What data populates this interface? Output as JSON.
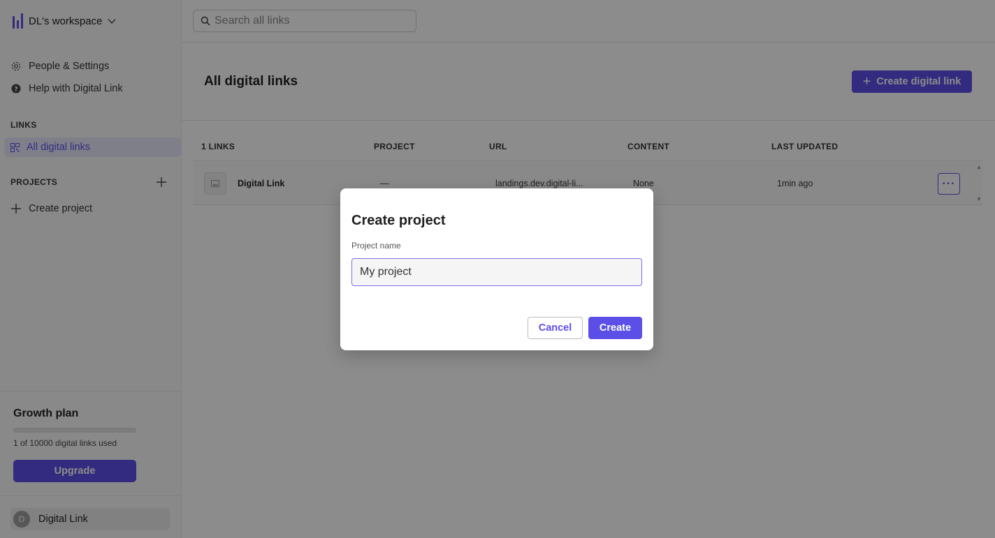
{
  "workspace": {
    "name": "DL's workspace"
  },
  "sidebar": {
    "links": [
      {
        "label": "People & Settings",
        "icon": "gear-icon"
      },
      {
        "label": "Help with Digital Link",
        "icon": "help-circle-icon"
      }
    ],
    "links_section": "LINKS",
    "active_item": {
      "label": "All digital links",
      "icon": "qr-grid-icon"
    },
    "projects_section": "PROJECTS",
    "create_project": "Create project"
  },
  "plan": {
    "title": "Growth plan",
    "usage_text": "1 of 10000 digital links used",
    "used_fraction": 0.0001,
    "upgrade_label": "Upgrade"
  },
  "user": {
    "initial": "D",
    "name": "Digital Link"
  },
  "search": {
    "placeholder": "Search all links"
  },
  "main": {
    "title": "All digital links",
    "create_button": "Create digital link",
    "columns": [
      "1 LINKS",
      "PROJECT",
      "URL",
      "CONTENT",
      "LAST UPDATED"
    ],
    "rows": [
      {
        "name": "Digital Link",
        "project": "—",
        "url": "landings.dev.digital-li...",
        "content": "None",
        "updated": "1min ago"
      }
    ]
  },
  "modal": {
    "title": "Create project",
    "field_label": "Project name",
    "field_value": "My project",
    "cancel_label": "Cancel",
    "create_label": "Create"
  },
  "colors": {
    "accent": "#5b4fe8",
    "overlay": "rgba(0,0,0,0.45)"
  }
}
